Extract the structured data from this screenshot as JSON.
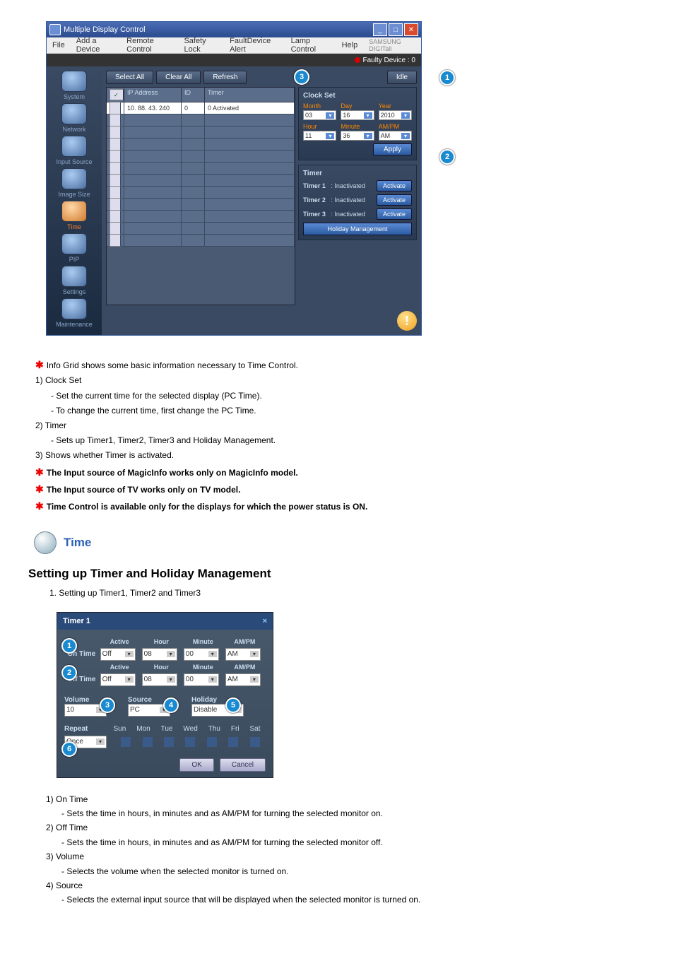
{
  "app": {
    "title": "Multiple Display Control",
    "menu": [
      "File",
      "Add a Device",
      "Remote Control",
      "Safety Lock",
      "FaultDevice Alert",
      "Lamp Control",
      "Help"
    ],
    "brand": "SAMSUNG DIGITall",
    "faulty": "Faulty Device : 0"
  },
  "toolbar": {
    "select_all": "Select All",
    "clear_all": "Clear All",
    "refresh": "Refresh",
    "idle": "Idle"
  },
  "sidebar": {
    "items": [
      "System",
      "Network",
      "Input Source",
      "Image Size",
      "Time",
      "PIP",
      "Settings",
      "Maintenance"
    ]
  },
  "grid": {
    "headers": {
      "ip": "IP Address",
      "id": "ID",
      "timer": "Timer"
    },
    "row": {
      "ip": "10. 88. 43. 240",
      "id": "0",
      "timer": "0 Activated"
    }
  },
  "clock": {
    "title": "Clock Set",
    "month_l": "Month",
    "day_l": "Day",
    "year_l": "Year",
    "month": "03",
    "day": "16",
    "year": "2010",
    "hour_l": "Hour",
    "minute_l": "Minute",
    "ampm_l": "AM/PM",
    "hour": "11",
    "minute": "36",
    "ampm": "AM",
    "apply": "Apply"
  },
  "timer": {
    "title": "Timer",
    "t1": "Timer 1",
    "t2": "Timer 2",
    "t3": "Timer 3",
    "status": ": Inactivated",
    "activate": "Activate",
    "holiday": "Holiday Management"
  },
  "text": {
    "l1": "Info Grid shows some basic information necessary to Time Control.",
    "l2": "1) Clock Set",
    "l2a": "- Set the current time for the selected display (PC Time).",
    "l2b": "- To change the current time, first change the PC Time.",
    "l3": "2) Timer",
    "l3a": "- Sets up Timer1, Timer2, Timer3 and Holiday Management.",
    "l4": "3) Shows whether Timer is activated.",
    "l5": "The Input source of MagicInfo works only on MagicInfo model.",
    "l6": "The Input source of TV works only on TV model.",
    "l7": "Time Control is available only for the displays for which the power status is ON."
  },
  "section2": {
    "title": "Time"
  },
  "subtitle": "Setting up Timer and Holiday Management",
  "numlist1": "1.  Setting up Timer1, Timer2 and Timer3",
  "dialog": {
    "title": "Timer 1",
    "col": {
      "active": "Active",
      "hour": "Hour",
      "minute": "Minute",
      "ampm": "AM/PM"
    },
    "on": "On Time",
    "off": "Off Time",
    "active_val": "Off",
    "hour_val": "08",
    "minute_val": "00",
    "ampm_val": "AM",
    "volume_l": "Volume",
    "volume": "10",
    "source_l": "Source",
    "source": "PC",
    "holiday_l": "Holiday",
    "holiday": "Disable",
    "repeat_l": "Repeat",
    "repeat": "Once",
    "days": [
      "Sun",
      "Mon",
      "Tue",
      "Wed",
      "Thu",
      "Fri",
      "Sat"
    ],
    "ok": "OK",
    "cancel": "Cancel"
  },
  "desc": {
    "d1": "1) On Time",
    "d1a": "- Sets the time in hours, in minutes and as AM/PM for turning the selected monitor on.",
    "d2": "2) Off Time",
    "d2a": "- Sets the time in hours, in minutes and as AM/PM for turning the selected monitor off.",
    "d3": "3) Volume",
    "d3a": "- Selects the volume when the selected monitor is turned on.",
    "d4": "4) Source",
    "d4a": "- Selects the external input source that will be displayed when the selected monitor is turned on."
  }
}
